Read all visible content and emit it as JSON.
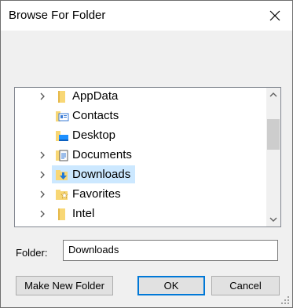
{
  "window": {
    "title": "Browse For Folder"
  },
  "tree": {
    "items": [
      {
        "label": "AppData",
        "expandable": true,
        "icon": "folder-icon"
      },
      {
        "label": "Contacts",
        "expandable": false,
        "icon": "contacts-folder-icon"
      },
      {
        "label": "Desktop",
        "expandable": false,
        "icon": "desktop-folder-icon"
      },
      {
        "label": "Documents",
        "expandable": true,
        "icon": "documents-folder-icon"
      },
      {
        "label": "Downloads",
        "expandable": true,
        "icon": "downloads-folder-icon",
        "selected": true
      },
      {
        "label": "Favorites",
        "expandable": true,
        "icon": "favorites-folder-icon"
      },
      {
        "label": "Intel",
        "expandable": true,
        "icon": "folder-icon"
      }
    ]
  },
  "folder": {
    "label": "Folder:",
    "value": "Downloads"
  },
  "buttons": {
    "make_new_folder": "Make New Folder",
    "ok": "OK",
    "cancel": "Cancel"
  },
  "colors": {
    "selection": "#cce8ff",
    "focus_border": "#0078d7",
    "folder_yellow": "#f8d775"
  }
}
